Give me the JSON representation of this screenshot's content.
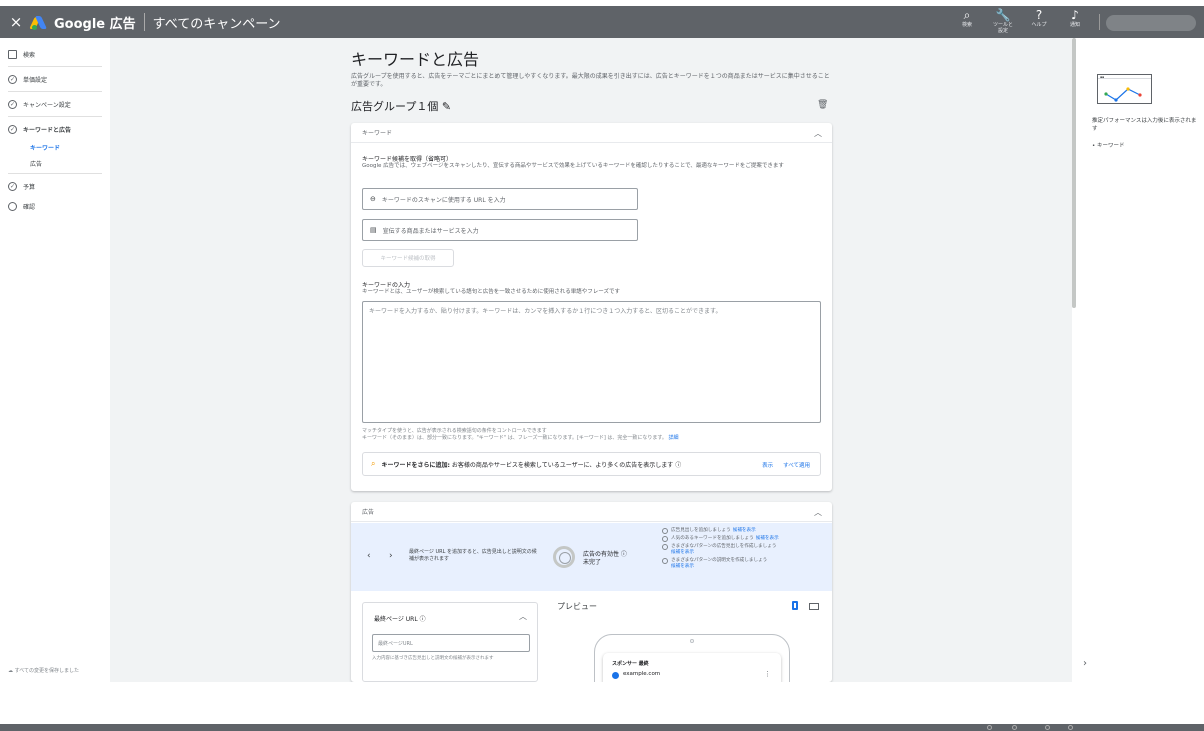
{
  "topbar": {
    "close_icon": "×",
    "brand": "Google 広告",
    "breadcrumb": "すべてのキャンペーン",
    "tools": [
      {
        "icon": "⌕",
        "label": "検索"
      },
      {
        "icon": "🔧",
        "label": "ツールと設定"
      },
      {
        "icon": "?",
        "label": "ヘルプ"
      },
      {
        "icon": "♪",
        "label": "通知"
      }
    ]
  },
  "sidebar": {
    "items": [
      {
        "label": "検索"
      },
      {
        "label": "単価設定"
      },
      {
        "label": "キャンペーン設定"
      },
      {
        "label": "キーワードと広告"
      },
      {
        "label": "キーワード"
      },
      {
        "label": "広告"
      },
      {
        "label": "予算"
      },
      {
        "label": "確認"
      }
    ],
    "save_status": "すべての変更を保存しました"
  },
  "page": {
    "title": "キーワードと広告",
    "desc": "広告グループを使用すると、広告をテーマごとにまとめて管理しやすくなります。最大限の成果を引き出すには、広告とキーワードを１つの商品またはサービスに集中させることが重要です。",
    "ad_group_title": "広告グループ１個"
  },
  "keywords": {
    "header": "キーワード",
    "suggest_title": "キーワード候補を取得（省略可）",
    "suggest_desc": "Google 広告では、ウェブページをスキャンしたり、宣伝する商品やサービスで効果を上げているキーワードを確認したりすることで、最適なキーワードをご提案できます",
    "url_placeholder": "キーワードのスキャンに使用する URL を入力",
    "product_placeholder": "宣伝する商品またはサービスを入力",
    "get_button": "キーワード候補の取得",
    "input_title": "キーワードの入力",
    "input_desc": "キーワードとは、ユーザーが検索している語句と広告を一致させるために使用される単語やフレーズです",
    "textarea_placeholder": "キーワードを入力するか、貼り付けます。キーワードは、カンマを挿入するか１行につき１つ入力すると、区切ることができます。",
    "match_note_1": "マッチタイプを使うと、広告が表示される検索語句の条件をコントロールできます",
    "match_note_2": "キーワード（そのまま）は、部分一致になります。\"キーワード\" は、フレーズ一致になります。[キーワード] は、完全一致になります。",
    "match_link": "詳細",
    "more_bold": "キーワードをさらに追加:",
    "more_text": "お客様の商品やサービスを検索しているユーザーに、より多くの広告を表示します ⓘ",
    "show_link": "表示",
    "apply_all_link": "すべて適用"
  },
  "ads": {
    "header": "広告",
    "hint_text": "最終ページ URL を追加すると、広告見出しと説明文の候補が表示されます",
    "strength_label": "広告の有効性 ⓘ",
    "strength_value": "未完了",
    "checklist": [
      {
        "text": "広告見出しを追加しましょう",
        "link": "候補を表示"
      },
      {
        "text": "人気のあるキーワードを追加しましょう",
        "link": "候補を表示"
      },
      {
        "text": "さまざまなパターンの広告見出しを作成しましょう",
        "link": "候補を表示"
      },
      {
        "text": "さまざまなパターンの説明文を作成しましょう",
        "link": "候補を表示"
      }
    ],
    "url_title": "最終ページ URL ⓘ",
    "url_placeholder": "最終ページURL",
    "url_help": "入力内容に基づき広告見出しと説明文の候補が表示されます",
    "preview_label": "プレビュー",
    "sponsored": "スポンサー 最終",
    "domain": "example.com"
  },
  "right_panel": {
    "text": "推定パフォーマンスは入力後に表示されます",
    "bullet": "• キーワード"
  },
  "colors": {
    "topbar": "#5f6368",
    "accent": "#1a73e8",
    "hint_bg": "#e8f0fe",
    "main_bg": "#f1f3f4"
  }
}
